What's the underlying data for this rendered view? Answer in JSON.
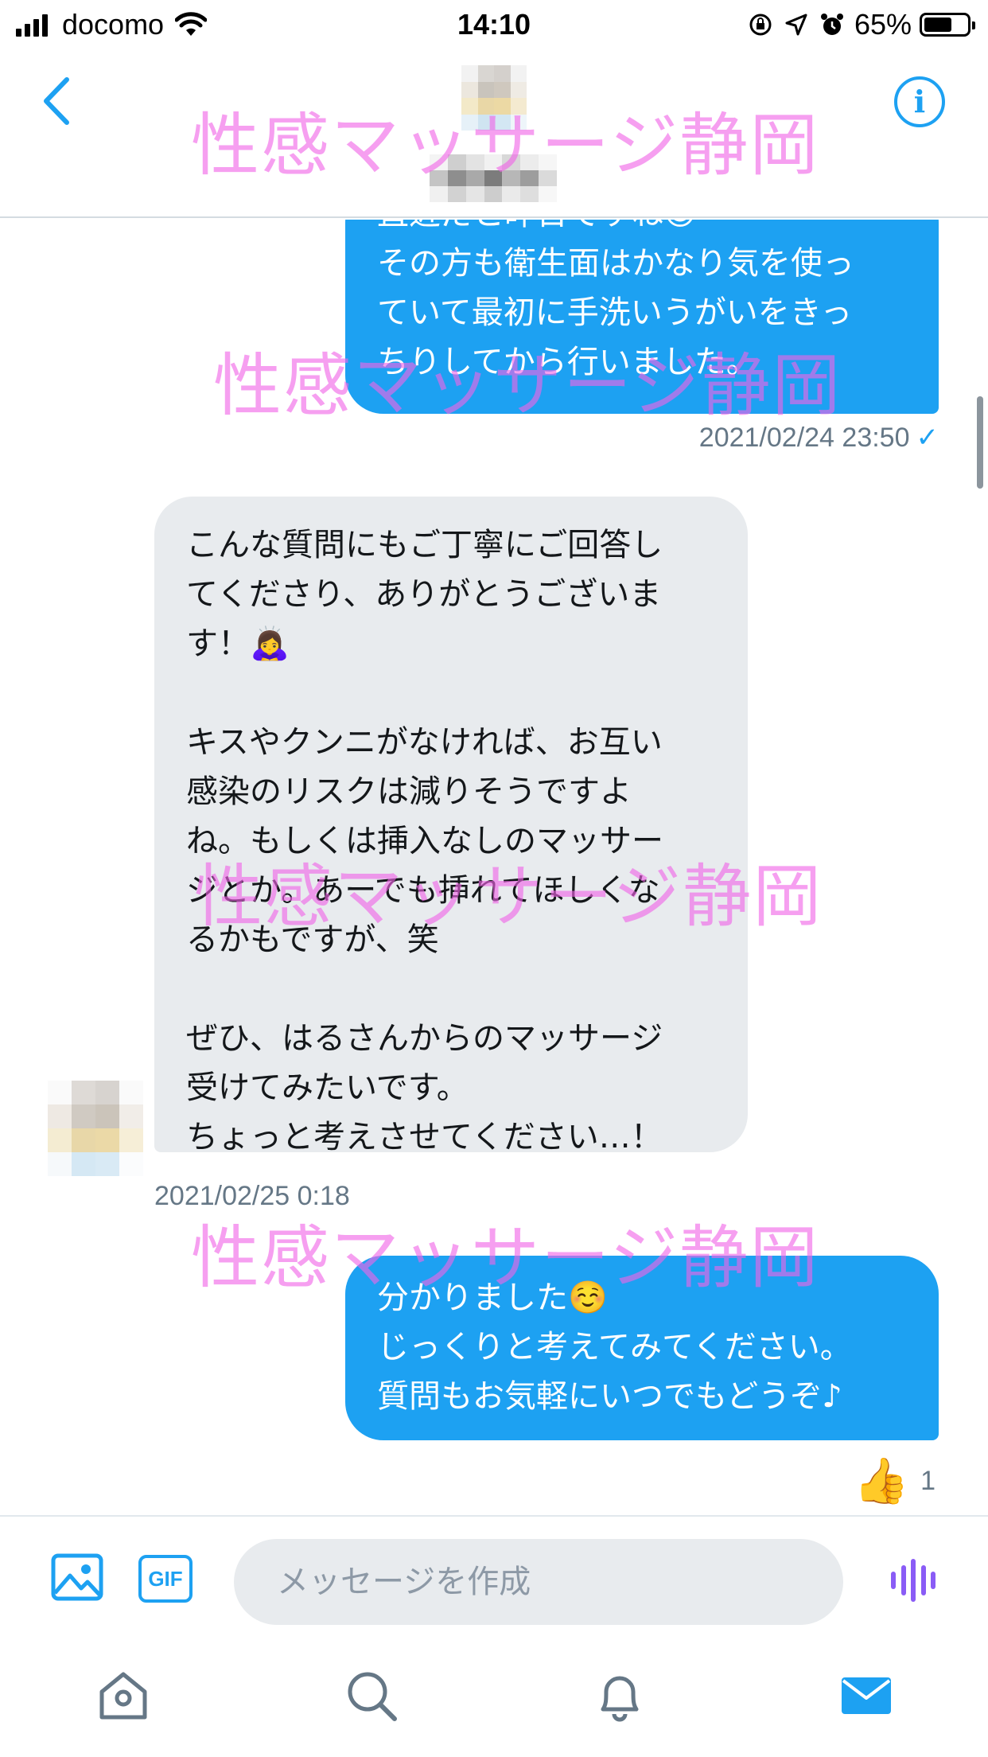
{
  "status_bar": {
    "carrier": "docomo",
    "time": "14:10",
    "battery": "65%",
    "battery_level": 0.65
  },
  "nav": {
    "back_icon": "chevron-left-icon",
    "info_icon": "info-icon",
    "info_glyph": "i"
  },
  "messages": [
    {
      "direction": "out",
      "text": "直近だと昨日ですね😌\nその方も衛生面はかなり気を使っ\nていて最初に手洗いうがいをきっ\nちりしてから行いました。"
    },
    {
      "direction": "in",
      "text": "こんな質問にもご丁寧にご回答し\nてくださり、ありがとうございま\nす！🙇‍♀️\n\nキスやクンニがなければ、お互い\n感染のリスクは減りそうですよ\nね。もしくは挿入なしのマッサー\nジとか。あーでも挿れてほしくな\nるかもですが、笑\n\nぜひ、はるさんからのマッサージ\n受けてみたいです。\nちょっと考えさせてください…！"
    },
    {
      "direction": "out",
      "text": "分かりました☺️\nじっくりと考えてみてください。\n質問もお気軽にいつでもどうぞ♪"
    }
  ],
  "timestamps": {
    "t1": "2021/02/24 23:50",
    "t1_check": "✓",
    "t2": "2021/02/25 0:18"
  },
  "reaction": {
    "emoji": "👍",
    "count": "1"
  },
  "watermark": "性感マッサージ静岡",
  "composer": {
    "placeholder": "メッセージを作成",
    "gif_label": "GIF"
  },
  "tabs": [
    "home-icon",
    "search-icon",
    "notifications-icon",
    "messages-icon"
  ],
  "colors": {
    "accent": "#1da1f2",
    "incoming_bubble": "#e8ebee",
    "watermark": "#f064e6",
    "voice": "#8a5cf6"
  }
}
